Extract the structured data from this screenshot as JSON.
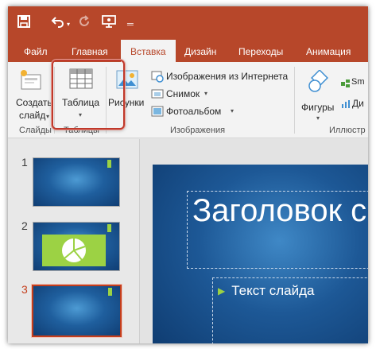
{
  "quick_access": {
    "save_icon": "save-icon",
    "undo_icon": "undo-icon",
    "redo_icon": "redo-icon",
    "slideshow_icon": "start-slideshow-icon",
    "customize_icon": "customize-toolbar-icon"
  },
  "tabs": [
    {
      "label": "Файл"
    },
    {
      "label": "Главная"
    },
    {
      "label": "Вставка",
      "active": true
    },
    {
      "label": "Дизайн"
    },
    {
      "label": "Переходы"
    },
    {
      "label": "Анимация"
    }
  ],
  "ribbon": {
    "slides": {
      "new_slide_line1": "Создать",
      "new_slide_line2": "слайд",
      "group": "Слайды"
    },
    "tables": {
      "table_label": "Таблица",
      "group": "Таблицы"
    },
    "images": {
      "pictures": "Рисунки",
      "online": "Изображения из Интернета",
      "screenshot": "Снимок",
      "album": "Фотоальбом",
      "group": "Изображения"
    },
    "illustrations": {
      "shapes": "Фигуры",
      "smartart": "Sm",
      "chart": "Ди",
      "group": "Иллюстр"
    }
  },
  "slides": [
    {
      "number": "1"
    },
    {
      "number": "2"
    },
    {
      "number": "3",
      "selected": true
    }
  ],
  "editor": {
    "title": "Заголовок с",
    "bullet": "Текст слайда"
  },
  "colors": {
    "accent": "#b7472a",
    "highlight": "#c0392b",
    "green": "#9cd244"
  }
}
